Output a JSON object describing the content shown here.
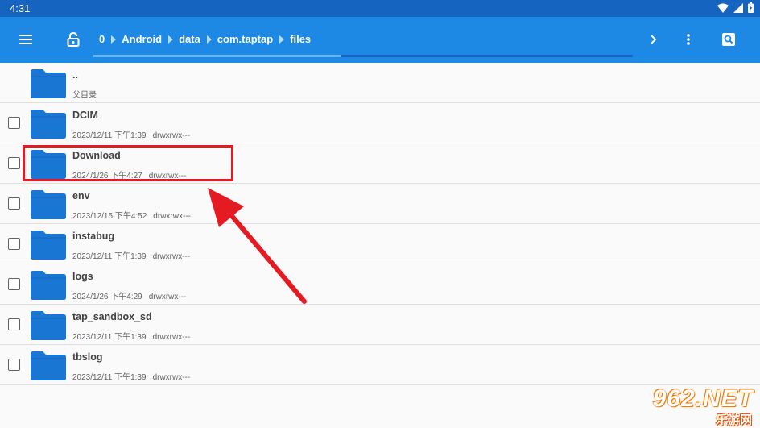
{
  "status_bar": {
    "time": "4:31"
  },
  "toolbar": {
    "menu_icon": "hamburger-menu-icon",
    "lock_icon": "unlock-icon",
    "breadcrumb": [
      "0",
      "Android",
      "data",
      "com.taptap",
      "files"
    ],
    "forward_icon": "chevron-right-icon",
    "more_icon": "more-vert-icon",
    "search_icon": "search-icon",
    "progress": 0.46
  },
  "files": [
    {
      "name": "..",
      "meta": "父目录",
      "selectable": false
    },
    {
      "name": "DCIM",
      "date": "2023/12/11 下午1:39",
      "perm": "drwxrwx---",
      "selectable": true
    },
    {
      "name": "Download",
      "date": "2024/1/26 下午4:27",
      "perm": "drwxrwx---",
      "selectable": true
    },
    {
      "name": "env",
      "date": "2023/12/15 下午4:52",
      "perm": "drwxrwx---",
      "selectable": true
    },
    {
      "name": "instabug",
      "date": "2023/12/11 下午1:39",
      "perm": "drwxrwx---",
      "selectable": true
    },
    {
      "name": "logs",
      "date": "2024/1/26 下午4:29",
      "perm": "drwxrwx---",
      "selectable": true
    },
    {
      "name": "tap_sandbox_sd",
      "date": "2023/12/11 下午1:39",
      "perm": "drwxrwx---",
      "selectable": true
    },
    {
      "name": "tbslog",
      "date": "2023/12/11 下午1:39",
      "perm": "drwxrwx---",
      "selectable": true
    }
  ],
  "watermark": {
    "top": "962.NET",
    "bottom": "乐游网"
  },
  "colors": {
    "toolbar": "#1e88e5",
    "status_bar": "#1565c0",
    "folder": "#1976d2",
    "annotation": "#e51b23"
  }
}
